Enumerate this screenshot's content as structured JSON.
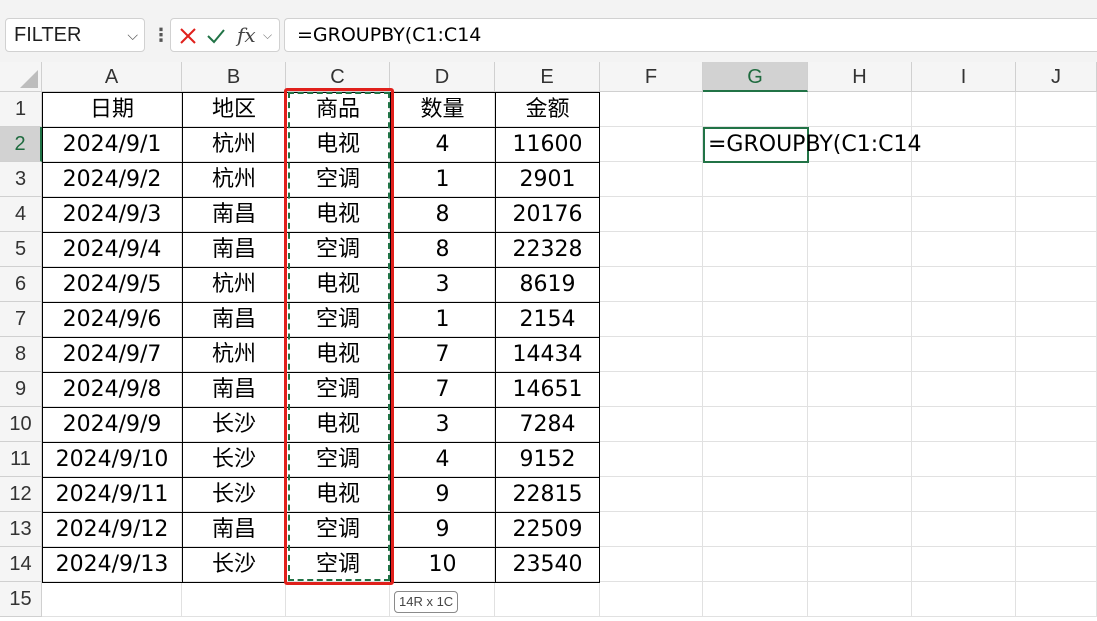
{
  "formula_bar": {
    "name_box": "FILTER",
    "name_box_icon": "chevron-down-icon",
    "options_icon": "more-vertical-icon",
    "cancel_icon": "cancel-x-icon",
    "enter_icon": "check-icon",
    "fx_label": "fx",
    "formula": "=GROUPBY(C1:C14"
  },
  "columns": [
    "A",
    "B",
    "C",
    "D",
    "E",
    "F",
    "G",
    "H",
    "I",
    "J"
  ],
  "selected_column": "G",
  "rows": [
    "1",
    "2",
    "3",
    "4",
    "5",
    "6",
    "7",
    "8",
    "9",
    "10",
    "11",
    "12",
    "13",
    "14",
    "15"
  ],
  "selected_row": "2",
  "table": {
    "headers": [
      "日期",
      "地区",
      "商品",
      "数量",
      "金额"
    ],
    "rows": [
      [
        "2024/9/1",
        "杭州",
        "电视",
        "4",
        "11600"
      ],
      [
        "2024/9/2",
        "杭州",
        "空调",
        "1",
        "2901"
      ],
      [
        "2024/9/3",
        "南昌",
        "电视",
        "8",
        "20176"
      ],
      [
        "2024/9/4",
        "南昌",
        "空调",
        "8",
        "22328"
      ],
      [
        "2024/9/5",
        "杭州",
        "电视",
        "3",
        "8619"
      ],
      [
        "2024/9/6",
        "南昌",
        "空调",
        "1",
        "2154"
      ],
      [
        "2024/9/7",
        "杭州",
        "电视",
        "7",
        "14434"
      ],
      [
        "2024/9/8",
        "南昌",
        "空调",
        "7",
        "14651"
      ],
      [
        "2024/9/9",
        "长沙",
        "电视",
        "3",
        "7284"
      ],
      [
        "2024/9/10",
        "长沙",
        "空调",
        "4",
        "9152"
      ],
      [
        "2024/9/11",
        "长沙",
        "电视",
        "9",
        "22815"
      ],
      [
        "2024/9/12",
        "南昌",
        "空调",
        "9",
        "22509"
      ],
      [
        "2024/9/13",
        "长沙",
        "空调",
        "10",
        "23540"
      ]
    ]
  },
  "active_cell": {
    "ref": "G2",
    "content": "=GROUPBY(C1:C14"
  },
  "selection_badge": "14R x 1C",
  "colors": {
    "accent_green": "#217346",
    "highlight_red": "#e0201b"
  }
}
